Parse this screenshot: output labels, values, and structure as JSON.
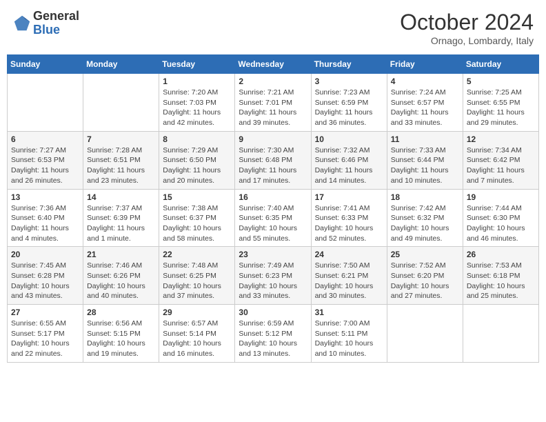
{
  "logo": {
    "text_general": "General",
    "text_blue": "Blue"
  },
  "header": {
    "month": "October 2024",
    "location": "Ornago, Lombardy, Italy"
  },
  "days_of_week": [
    "Sunday",
    "Monday",
    "Tuesday",
    "Wednesday",
    "Thursday",
    "Friday",
    "Saturday"
  ],
  "weeks": [
    [
      {
        "day": "",
        "sunrise": "",
        "sunset": "",
        "daylight": ""
      },
      {
        "day": "",
        "sunrise": "",
        "sunset": "",
        "daylight": ""
      },
      {
        "day": "1",
        "sunrise": "Sunrise: 7:20 AM",
        "sunset": "Sunset: 7:03 PM",
        "daylight": "Daylight: 11 hours and 42 minutes."
      },
      {
        "day": "2",
        "sunrise": "Sunrise: 7:21 AM",
        "sunset": "Sunset: 7:01 PM",
        "daylight": "Daylight: 11 hours and 39 minutes."
      },
      {
        "day": "3",
        "sunrise": "Sunrise: 7:23 AM",
        "sunset": "Sunset: 6:59 PM",
        "daylight": "Daylight: 11 hours and 36 minutes."
      },
      {
        "day": "4",
        "sunrise": "Sunrise: 7:24 AM",
        "sunset": "Sunset: 6:57 PM",
        "daylight": "Daylight: 11 hours and 33 minutes."
      },
      {
        "day": "5",
        "sunrise": "Sunrise: 7:25 AM",
        "sunset": "Sunset: 6:55 PM",
        "daylight": "Daylight: 11 hours and 29 minutes."
      }
    ],
    [
      {
        "day": "6",
        "sunrise": "Sunrise: 7:27 AM",
        "sunset": "Sunset: 6:53 PM",
        "daylight": "Daylight: 11 hours and 26 minutes."
      },
      {
        "day": "7",
        "sunrise": "Sunrise: 7:28 AM",
        "sunset": "Sunset: 6:51 PM",
        "daylight": "Daylight: 11 hours and 23 minutes."
      },
      {
        "day": "8",
        "sunrise": "Sunrise: 7:29 AM",
        "sunset": "Sunset: 6:50 PM",
        "daylight": "Daylight: 11 hours and 20 minutes."
      },
      {
        "day": "9",
        "sunrise": "Sunrise: 7:30 AM",
        "sunset": "Sunset: 6:48 PM",
        "daylight": "Daylight: 11 hours and 17 minutes."
      },
      {
        "day": "10",
        "sunrise": "Sunrise: 7:32 AM",
        "sunset": "Sunset: 6:46 PM",
        "daylight": "Daylight: 11 hours and 14 minutes."
      },
      {
        "day": "11",
        "sunrise": "Sunrise: 7:33 AM",
        "sunset": "Sunset: 6:44 PM",
        "daylight": "Daylight: 11 hours and 10 minutes."
      },
      {
        "day": "12",
        "sunrise": "Sunrise: 7:34 AM",
        "sunset": "Sunset: 6:42 PM",
        "daylight": "Daylight: 11 hours and 7 minutes."
      }
    ],
    [
      {
        "day": "13",
        "sunrise": "Sunrise: 7:36 AM",
        "sunset": "Sunset: 6:40 PM",
        "daylight": "Daylight: 11 hours and 4 minutes."
      },
      {
        "day": "14",
        "sunrise": "Sunrise: 7:37 AM",
        "sunset": "Sunset: 6:39 PM",
        "daylight": "Daylight: 11 hours and 1 minute."
      },
      {
        "day": "15",
        "sunrise": "Sunrise: 7:38 AM",
        "sunset": "Sunset: 6:37 PM",
        "daylight": "Daylight: 10 hours and 58 minutes."
      },
      {
        "day": "16",
        "sunrise": "Sunrise: 7:40 AM",
        "sunset": "Sunset: 6:35 PM",
        "daylight": "Daylight: 10 hours and 55 minutes."
      },
      {
        "day": "17",
        "sunrise": "Sunrise: 7:41 AM",
        "sunset": "Sunset: 6:33 PM",
        "daylight": "Daylight: 10 hours and 52 minutes."
      },
      {
        "day": "18",
        "sunrise": "Sunrise: 7:42 AM",
        "sunset": "Sunset: 6:32 PM",
        "daylight": "Daylight: 10 hours and 49 minutes."
      },
      {
        "day": "19",
        "sunrise": "Sunrise: 7:44 AM",
        "sunset": "Sunset: 6:30 PM",
        "daylight": "Daylight: 10 hours and 46 minutes."
      }
    ],
    [
      {
        "day": "20",
        "sunrise": "Sunrise: 7:45 AM",
        "sunset": "Sunset: 6:28 PM",
        "daylight": "Daylight: 10 hours and 43 minutes."
      },
      {
        "day": "21",
        "sunrise": "Sunrise: 7:46 AM",
        "sunset": "Sunset: 6:26 PM",
        "daylight": "Daylight: 10 hours and 40 minutes."
      },
      {
        "day": "22",
        "sunrise": "Sunrise: 7:48 AM",
        "sunset": "Sunset: 6:25 PM",
        "daylight": "Daylight: 10 hours and 37 minutes."
      },
      {
        "day": "23",
        "sunrise": "Sunrise: 7:49 AM",
        "sunset": "Sunset: 6:23 PM",
        "daylight": "Daylight: 10 hours and 33 minutes."
      },
      {
        "day": "24",
        "sunrise": "Sunrise: 7:50 AM",
        "sunset": "Sunset: 6:21 PM",
        "daylight": "Daylight: 10 hours and 30 minutes."
      },
      {
        "day": "25",
        "sunrise": "Sunrise: 7:52 AM",
        "sunset": "Sunset: 6:20 PM",
        "daylight": "Daylight: 10 hours and 27 minutes."
      },
      {
        "day": "26",
        "sunrise": "Sunrise: 7:53 AM",
        "sunset": "Sunset: 6:18 PM",
        "daylight": "Daylight: 10 hours and 25 minutes."
      }
    ],
    [
      {
        "day": "27",
        "sunrise": "Sunrise: 6:55 AM",
        "sunset": "Sunset: 5:17 PM",
        "daylight": "Daylight: 10 hours and 22 minutes."
      },
      {
        "day": "28",
        "sunrise": "Sunrise: 6:56 AM",
        "sunset": "Sunset: 5:15 PM",
        "daylight": "Daylight: 10 hours and 19 minutes."
      },
      {
        "day": "29",
        "sunrise": "Sunrise: 6:57 AM",
        "sunset": "Sunset: 5:14 PM",
        "daylight": "Daylight: 10 hours and 16 minutes."
      },
      {
        "day": "30",
        "sunrise": "Sunrise: 6:59 AM",
        "sunset": "Sunset: 5:12 PM",
        "daylight": "Daylight: 10 hours and 13 minutes."
      },
      {
        "day": "31",
        "sunrise": "Sunrise: 7:00 AM",
        "sunset": "Sunset: 5:11 PM",
        "daylight": "Daylight: 10 hours and 10 minutes."
      },
      {
        "day": "",
        "sunrise": "",
        "sunset": "",
        "daylight": ""
      },
      {
        "day": "",
        "sunrise": "",
        "sunset": "",
        "daylight": ""
      }
    ]
  ]
}
